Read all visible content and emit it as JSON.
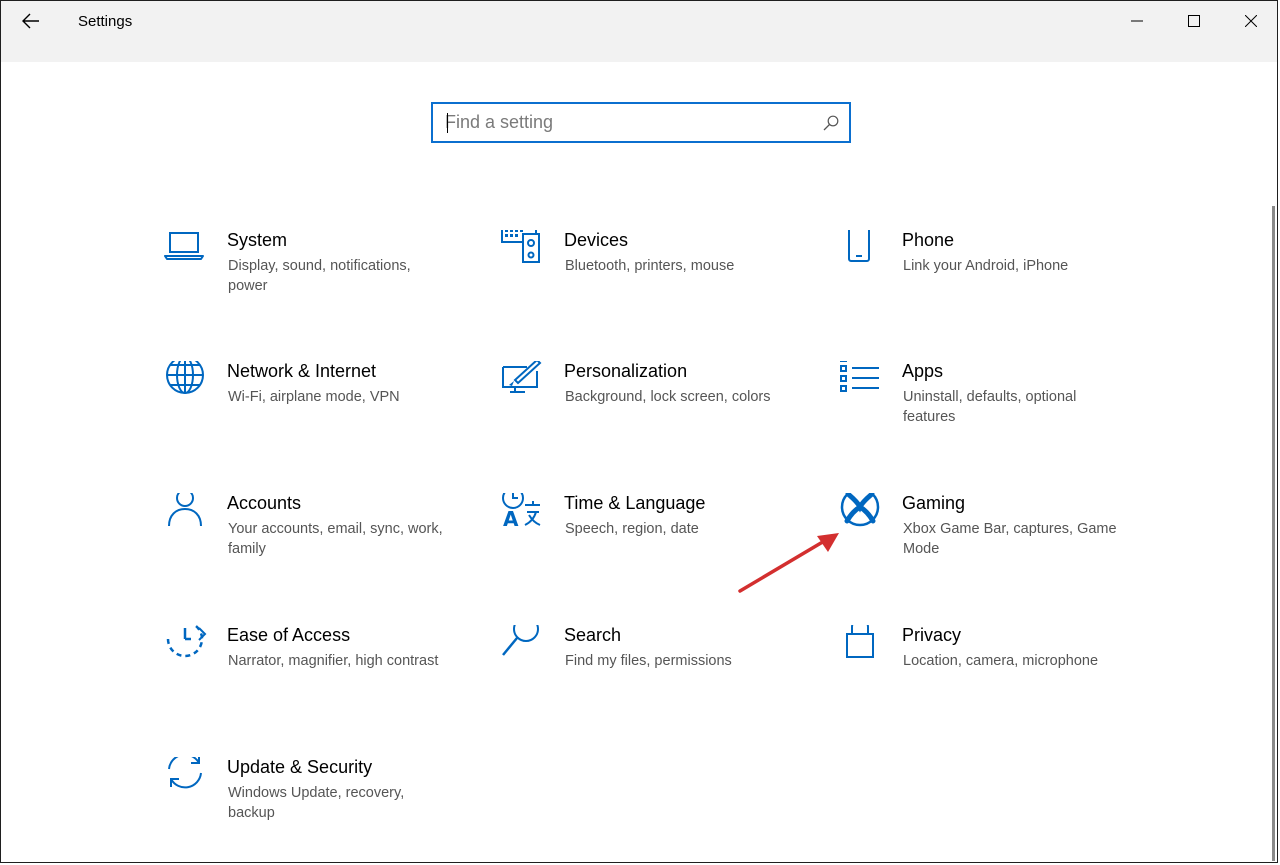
{
  "window": {
    "title": "Settings",
    "accent_color": "#0067c0"
  },
  "search": {
    "placeholder": "Find a setting"
  },
  "categories": [
    {
      "name": "System",
      "desc": "Display, sound, notifications, power",
      "icon": "laptop-icon"
    },
    {
      "name": "Devices",
      "desc": "Bluetooth, printers, mouse",
      "icon": "keyboard-speaker-icon"
    },
    {
      "name": "Phone",
      "desc": "Link your Android, iPhone",
      "icon": "phone-icon"
    },
    {
      "name": "Network & Internet",
      "desc": "Wi-Fi, airplane mode, VPN",
      "icon": "globe-icon"
    },
    {
      "name": "Personalization",
      "desc": "Background, lock screen, colors",
      "icon": "paint-brush-icon"
    },
    {
      "name": "Apps",
      "desc": "Uninstall, defaults, optional features",
      "icon": "apps-list-icon"
    },
    {
      "name": "Accounts",
      "desc": "Your accounts, email, sync, work, family",
      "icon": "person-icon"
    },
    {
      "name": "Time & Language",
      "desc": "Speech, region, date",
      "icon": "clock-language-icon"
    },
    {
      "name": "Gaming",
      "desc": "Xbox Game Bar, captures, Game Mode",
      "icon": "xbox-icon"
    },
    {
      "name": "Ease of Access",
      "desc": "Narrator, magnifier, high contrast",
      "icon": "ease-of-access-icon"
    },
    {
      "name": "Search",
      "desc": "Find my files, permissions",
      "icon": "magnifier-icon"
    },
    {
      "name": "Privacy",
      "desc": "Location, camera, microphone",
      "icon": "lock-icon"
    },
    {
      "name": "Update & Security",
      "desc": "Windows Update, recovery, backup",
      "icon": "sync-arrows-icon"
    }
  ],
  "annotation": {
    "icon": "red-arrow-icon",
    "color": "#d32f2f"
  }
}
